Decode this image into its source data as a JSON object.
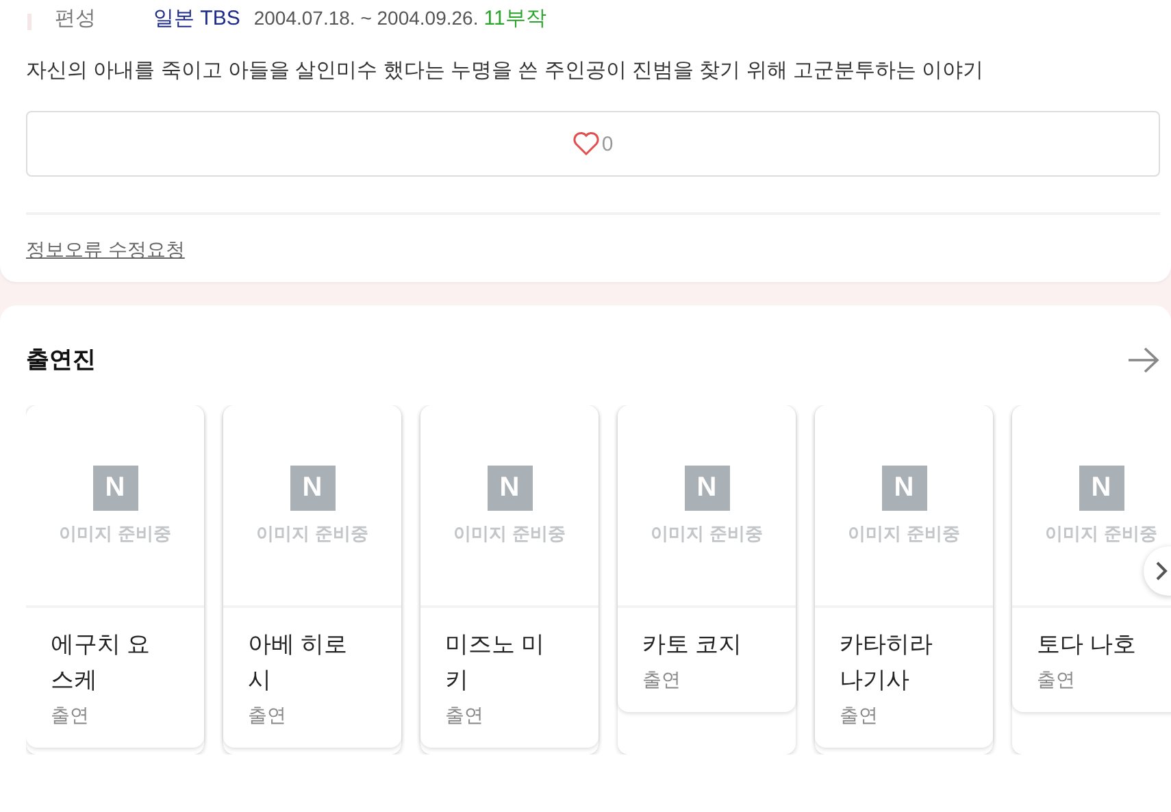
{
  "info": {
    "label": "편성",
    "channel": "일본 TBS",
    "period": "2004.07.18. ~ 2004.09.26.",
    "episodes": "11부작"
  },
  "synopsis": "자신의 아내를 죽이고 아들을 살인미수 했다는 누명을 쓴 주인공이 진범을 찾기 위해 고군분투하는 이야기",
  "like": {
    "count": "0",
    "liked": false
  },
  "report_link": "정보오류 수정요청",
  "cast": {
    "title": "출연진",
    "members": [
      {
        "logo": "N",
        "placeholder": "이미지 준비중",
        "name": "에구치 요스케",
        "role": "출연"
      },
      {
        "logo": "N",
        "placeholder": "이미지 준비중",
        "name": "아베 히로시",
        "role": "출연"
      },
      {
        "logo": "N",
        "placeholder": "이미지 준비중",
        "name": "미즈노 미키",
        "role": "출연"
      },
      {
        "logo": "N",
        "placeholder": "이미지 준비중",
        "name": "카토 코지",
        "role": "출연"
      },
      {
        "logo": "N",
        "placeholder": "이미지 준비중",
        "name": "카타히라 나기사",
        "role": "출연"
      },
      {
        "logo": "N",
        "placeholder": "이미지 준비중",
        "name": "토다 나호",
        "role": "출연"
      }
    ]
  }
}
